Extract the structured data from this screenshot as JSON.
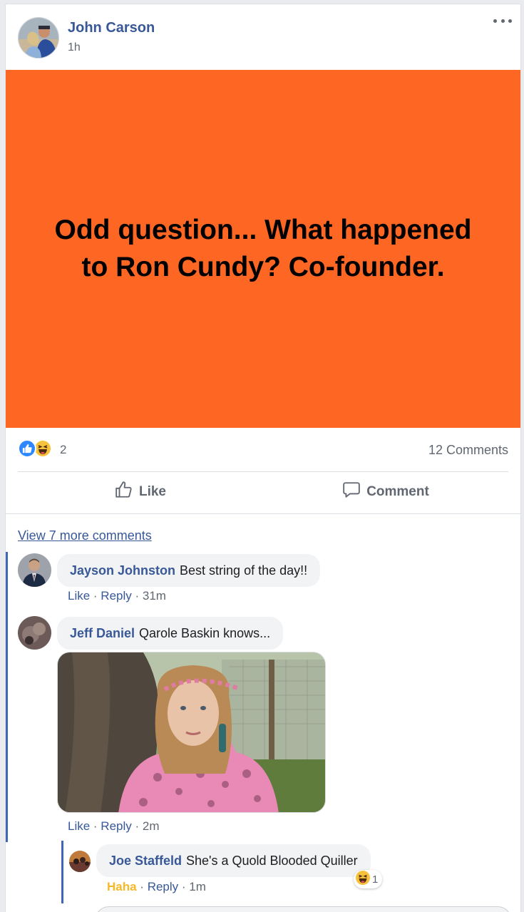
{
  "post": {
    "author": "John Carson",
    "time": "1h",
    "status_text": "Odd question... What happened to Ron Cundy? Co-founder.",
    "background_color": "#fd6623",
    "more_icon": "more-horizontal-icon"
  },
  "reactions": {
    "types": [
      "like",
      "haha"
    ],
    "count": "2",
    "comments_label": "12 Comments"
  },
  "actions": {
    "like_label": "Like",
    "comment_label": "Comment"
  },
  "comments_section": {
    "view_more": "View 7 more comments",
    "comments": [
      {
        "author": "Jayson Johnston",
        "text": "Best string of the day!!",
        "like": "Like",
        "reply": "Reply",
        "time": "31m"
      },
      {
        "author": "Jeff Daniel",
        "text": "Qarole Baskin knows...",
        "like": "Like",
        "reply": "Reply",
        "time": "2m",
        "attachment": "photo"
      }
    ],
    "replies": [
      {
        "author": "Joe Staffeld",
        "text": "She's a Quold Blooded Quiller",
        "reaction_label": "Haha",
        "reply": "Reply",
        "time": "1m",
        "reaction_count": "1"
      }
    ]
  },
  "separator": " · "
}
